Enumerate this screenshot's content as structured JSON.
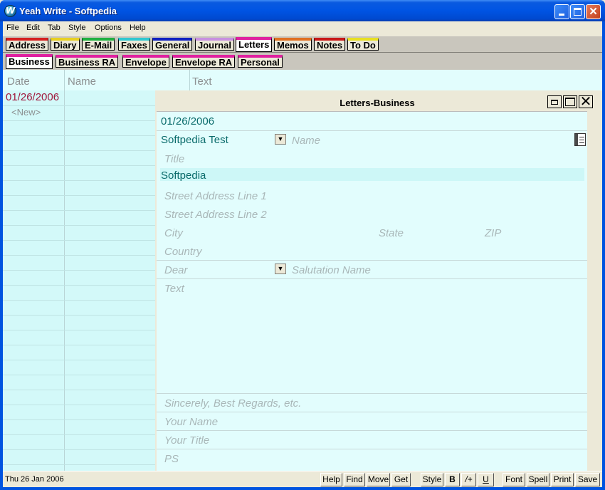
{
  "window": {
    "title": "Yeah Write - Softpedia",
    "app_icon": "W"
  },
  "menu": [
    "File",
    "Edit",
    "Tab",
    "Style",
    "Options",
    "Help"
  ],
  "tabs_row1": [
    {
      "label": "Address",
      "color": "#d42020"
    },
    {
      "label": "Diary",
      "color": "#e8d020"
    },
    {
      "label": "E-Mail",
      "color": "#20b040"
    },
    {
      "label": "Faxes",
      "color": "#30c8d0"
    },
    {
      "label": "General",
      "color": "#1020c0"
    },
    {
      "label": "Journal",
      "color": "#c890e0"
    },
    {
      "label": "Letters",
      "color": "#e020a0",
      "active": true
    },
    {
      "label": "Memos",
      "color": "#e07020"
    },
    {
      "label": "Notes",
      "color": "#c81818"
    },
    {
      "label": "To Do",
      "color": "#e8e020"
    }
  ],
  "tabs_row2": [
    {
      "label": "Business",
      "color": "#e020a0",
      "active": true
    },
    {
      "label": "Business RA",
      "color": "#e020a0"
    },
    {
      "label": "Envelope",
      "color": "#e020a0"
    },
    {
      "label": "Envelope RA",
      "color": "#e020a0"
    },
    {
      "label": "Personal",
      "color": "#e020a0"
    }
  ],
  "list": {
    "columns": [
      "Date",
      "Name",
      "Text"
    ],
    "rows": [
      {
        "date": "01/26/2006"
      }
    ],
    "new_item": "<New>"
  },
  "letter": {
    "title": "Letters-Business",
    "date": "01/26/2006",
    "recipient": "Softpedia Test",
    "name_placeholder": "Name",
    "title_placeholder": "Title",
    "company": "Softpedia",
    "street1_placeholder": "Street Address Line 1",
    "street2_placeholder": "Street Address Line 2",
    "city_placeholder": "City",
    "state_placeholder": "State",
    "zip_placeholder": "ZIP",
    "country_placeholder": "Country",
    "dear_placeholder": "Dear",
    "salutation_placeholder": "Salutation Name",
    "text_placeholder": "Text",
    "closing_placeholder": "Sincerely, Best Regards, etc.",
    "your_name_placeholder": "Your Name",
    "your_title_placeholder": "Your Title",
    "ps_placeholder": "PS"
  },
  "status": {
    "date": "Thu 26 Jan 2006",
    "buttons": [
      "Help",
      "Find",
      "Move",
      "Get",
      "Style",
      "B",
      "/+",
      "U",
      "Font",
      "Spell",
      "Print",
      "Save"
    ]
  }
}
